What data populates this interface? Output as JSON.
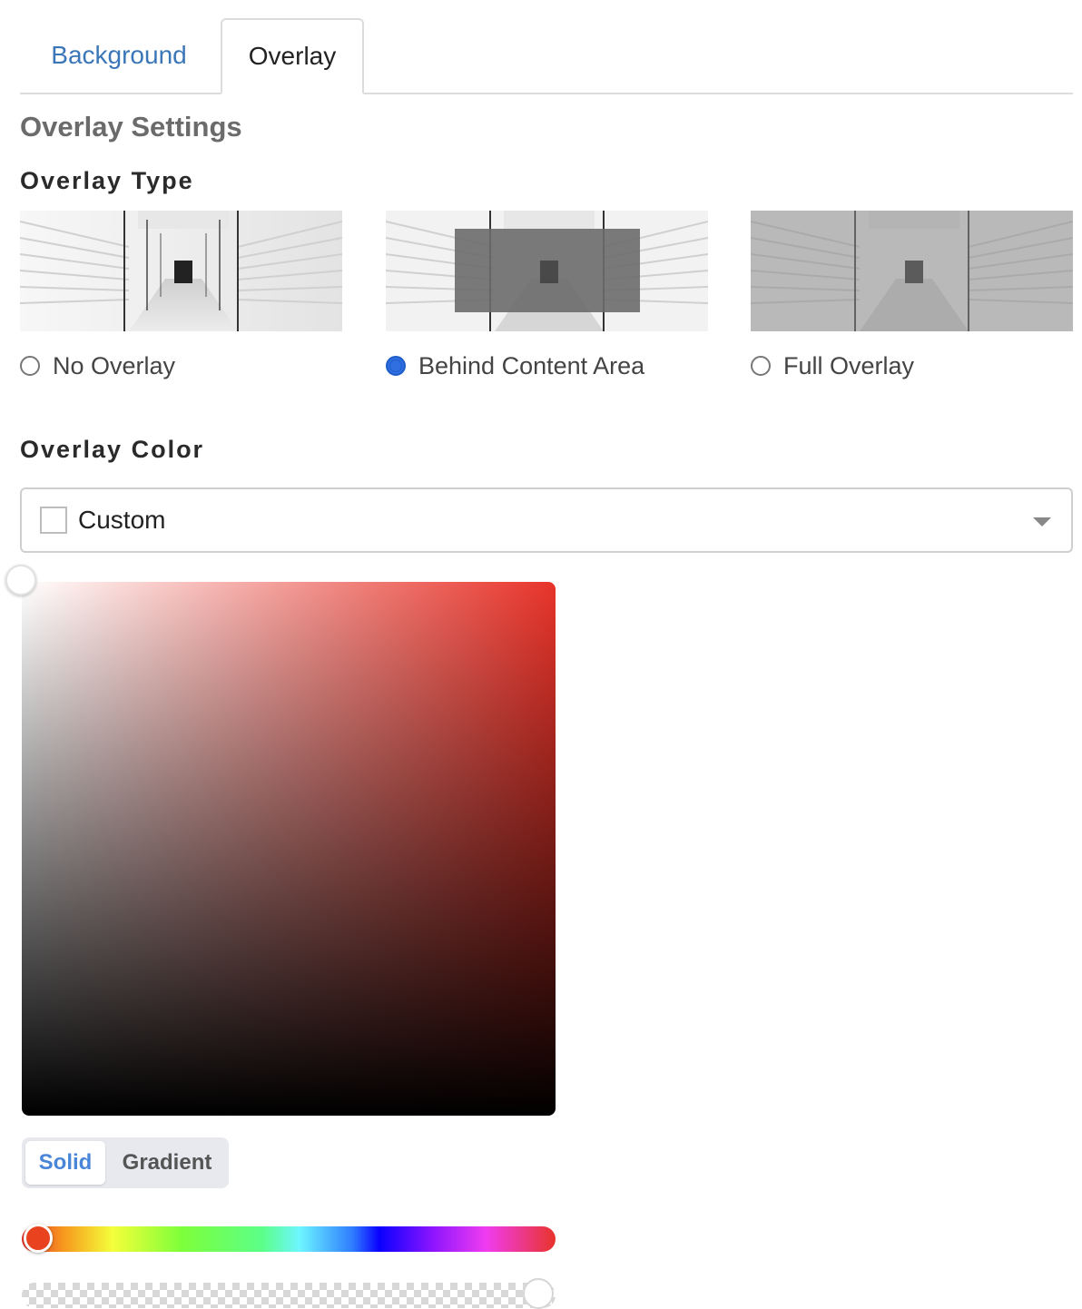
{
  "tabs": {
    "background": "Background",
    "overlay": "Overlay",
    "active": "Overlay"
  },
  "section": {
    "title": "Overlay Settings"
  },
  "overlay_type": {
    "label": "Overlay Type",
    "options": [
      {
        "label": "No Overlay",
        "checked": false
      },
      {
        "label": "Behind Content Area",
        "checked": true
      },
      {
        "label": "Full Overlay",
        "checked": false
      }
    ]
  },
  "overlay_color": {
    "label": "Overlay Color",
    "select_value": "Custom",
    "hue_color": "#e8342a",
    "mode": {
      "solid": "Solid",
      "gradient": "Gradient",
      "active": "Solid"
    }
  },
  "colors": {
    "accent": "#3a76b8",
    "radio_selected": "#2f6fe0",
    "segment_active_text": "#4a86d8"
  }
}
